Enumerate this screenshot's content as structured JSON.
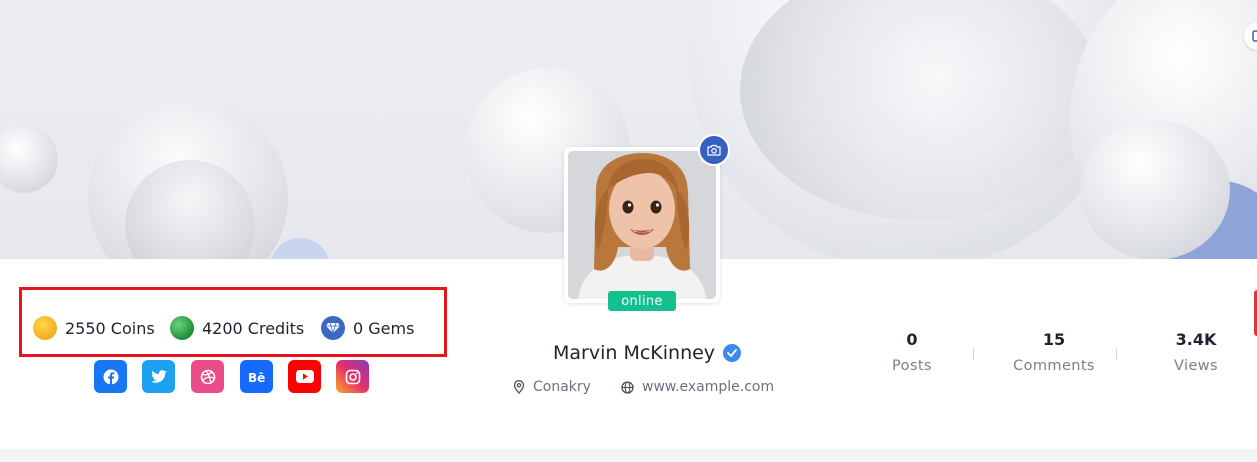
{
  "currency": {
    "coins": "2550 Coins",
    "credits": "4200 Credits",
    "gems": "0 Gems"
  },
  "social": [
    "facebook-icon",
    "twitter-icon",
    "dribbble-icon",
    "behance-icon",
    "youtube-icon",
    "instagram-icon"
  ],
  "social_colors": {
    "facebook": "#1877f2",
    "twitter": "#1da1f2",
    "dribbble": "#ea4c89",
    "behance": "#1769ff",
    "youtube": "#ff0000",
    "instagram": "#d6249f"
  },
  "profile": {
    "status": "online",
    "name": "Marvin McKinney",
    "location": "Conakry",
    "website": "www.example.com"
  },
  "stats": [
    {
      "value": "0",
      "label": "Posts"
    },
    {
      "value": "15",
      "label": "Comments"
    },
    {
      "value": "3.4K",
      "label": "Views"
    }
  ],
  "colors": {
    "accent": "#3561c0",
    "online": "#13c08e",
    "highlight_border": "#e8141a"
  }
}
